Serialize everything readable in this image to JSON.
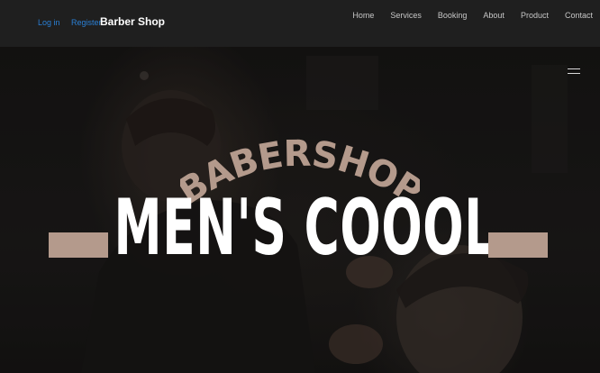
{
  "header": {
    "login_label": "Log in",
    "register_label": "Register",
    "brand": "Barber Shop",
    "nav": [
      "Home",
      "Services",
      "Booking",
      "About",
      "Product",
      "Contact"
    ]
  },
  "hero": {
    "arc_text": "BABERSHOP",
    "title": "MEN'S COOOL",
    "accent_color": "#b49a8c",
    "menu_icon": "hamburger-icon"
  }
}
